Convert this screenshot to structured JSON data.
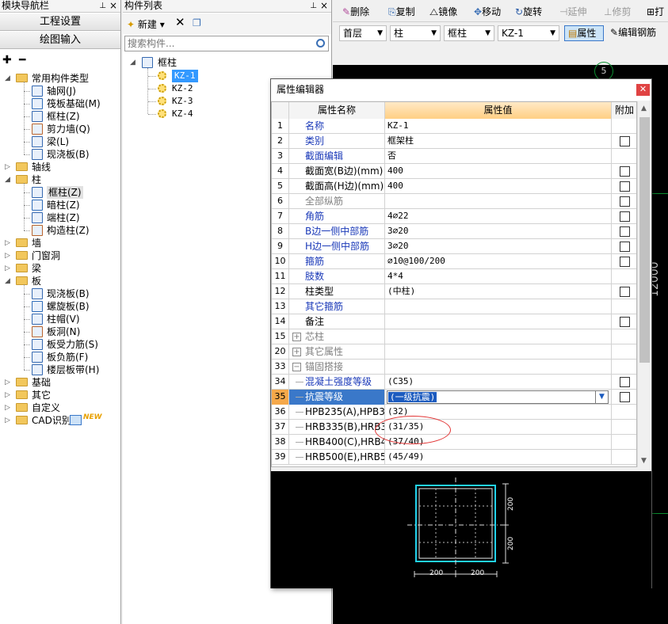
{
  "nav": {
    "title": "模块导航栏",
    "btn_project": "工程设置",
    "btn_drawing": "绘图输入",
    "tree": [
      {
        "label": "常用构件类型",
        "children": [
          "轴网(J)",
          "筏板基础(M)",
          "框柱(Z)",
          "剪力墙(Q)",
          "梁(L)",
          "现浇板(B)"
        ]
      },
      {
        "label": "轴线"
      },
      {
        "label": "柱",
        "children": [
          "框柱(Z)",
          "暗柱(Z)",
          "端柱(Z)",
          "构造柱(Z)"
        ]
      },
      {
        "label": "墙"
      },
      {
        "label": "门窗洞"
      },
      {
        "label": "梁"
      },
      {
        "label": "板",
        "children": [
          "现浇板(B)",
          "螺旋板(B)",
          "柱帽(V)",
          "板洞(N)",
          "板受力筋(S)",
          "板负筋(F)",
          "楼层板带(H)"
        ]
      },
      {
        "label": "基础"
      },
      {
        "label": "其它"
      },
      {
        "label": "自定义"
      },
      {
        "label": "CAD识别",
        "badge": "NEW"
      }
    ]
  },
  "list": {
    "title": "构件列表",
    "new_label": "新建",
    "search_placeholder": "搜索构件...",
    "group": "框柱",
    "items": [
      "KZ-1",
      "KZ-2",
      "KZ-3",
      "KZ-4"
    ],
    "selected": "KZ-1"
  },
  "toolbar1": {
    "delete": "删除",
    "copy": "复制",
    "mirror": "镜像",
    "move": "移动",
    "rotate": "旋转",
    "extend": "延伸",
    "trim": "修剪",
    "more": "打"
  },
  "toolbar2": {
    "floor": "首层",
    "type": "柱",
    "subtype": "框柱",
    "component": "KZ-1",
    "property": "属性",
    "edit_rebar": "编辑钢筋"
  },
  "canvas": {
    "axis_label": "5",
    "dimension": "12000"
  },
  "dialog": {
    "title": "属性编辑器",
    "col_name": "属性名称",
    "col_value": "属性值",
    "col_add": "附加",
    "rows": [
      {
        "no": "1",
        "name": "名称",
        "value": "KZ-1",
        "color": "blue",
        "check": false
      },
      {
        "no": "2",
        "name": "类别",
        "value": "框架柱",
        "color": "blue",
        "check": true
      },
      {
        "no": "3",
        "name": "截面编辑",
        "value": "否",
        "color": "blue",
        "check": false
      },
      {
        "no": "4",
        "name": "截面宽(B边)(mm)",
        "value": "400",
        "color": "dark",
        "check": true
      },
      {
        "no": "5",
        "name": "截面高(H边)(mm)",
        "value": "400",
        "color": "dark",
        "check": true
      },
      {
        "no": "6",
        "name": "全部纵筋",
        "value": "",
        "color": "gray",
        "check": true
      },
      {
        "no": "7",
        "name": "角筋",
        "value": "4⌀22",
        "color": "blue",
        "check": true
      },
      {
        "no": "8",
        "name": "B边一侧中部筋",
        "value": "3⌀20",
        "color": "blue",
        "check": true
      },
      {
        "no": "9",
        "name": "H边一侧中部筋",
        "value": "3⌀20",
        "color": "blue",
        "check": true
      },
      {
        "no": "10",
        "name": "箍筋",
        "value": "⌀10@100/200",
        "color": "blue",
        "check": true
      },
      {
        "no": "11",
        "name": "肢数",
        "value": "4*4",
        "color": "blue",
        "check": false
      },
      {
        "no": "12",
        "name": "柱类型",
        "value": "(中柱)",
        "color": "dark",
        "check": true
      },
      {
        "no": "13",
        "name": "其它箍筋",
        "value": "",
        "color": "blue",
        "check": false
      },
      {
        "no": "14",
        "name": "备注",
        "value": "",
        "color": "dark",
        "check": true
      },
      {
        "no": "15",
        "name": "芯柱",
        "value": "",
        "color": "gray",
        "check": false,
        "expand": "+"
      },
      {
        "no": "20",
        "name": "其它属性",
        "value": "",
        "color": "gray",
        "check": false,
        "expand": "+"
      },
      {
        "no": "33",
        "name": "锚固搭接",
        "value": "",
        "color": "gray",
        "check": false,
        "expand": "−"
      },
      {
        "no": "34",
        "name": "混凝土强度等级",
        "value": "(C35)",
        "color": "blue",
        "check": true,
        "sub": true
      },
      {
        "no": "35",
        "name": "抗震等级",
        "value": "(一级抗震)",
        "color": "blue",
        "check": true,
        "sub": true,
        "selected": true
      },
      {
        "no": "36",
        "name": "HPB235(A),HPB3",
        "value": "(32)",
        "color": "dark",
        "check": false,
        "sub": true
      },
      {
        "no": "37",
        "name": "HRB335(B),HRB3",
        "value": "(31/35)",
        "color": "dark",
        "check": false,
        "sub": true
      },
      {
        "no": "38",
        "name": "HRB400(C),HRB4",
        "value": "(37/40)",
        "color": "dark",
        "check": false,
        "sub": true
      },
      {
        "no": "39",
        "name": "HRB500(E),HRB5",
        "value": "(45/49)",
        "color": "dark",
        "check": false,
        "sub": true
      }
    ],
    "preview": {
      "dim_bottom_left": "200",
      "dim_bottom_right": "200",
      "dim_side_top": "200",
      "dim_side_bottom": "200"
    }
  }
}
